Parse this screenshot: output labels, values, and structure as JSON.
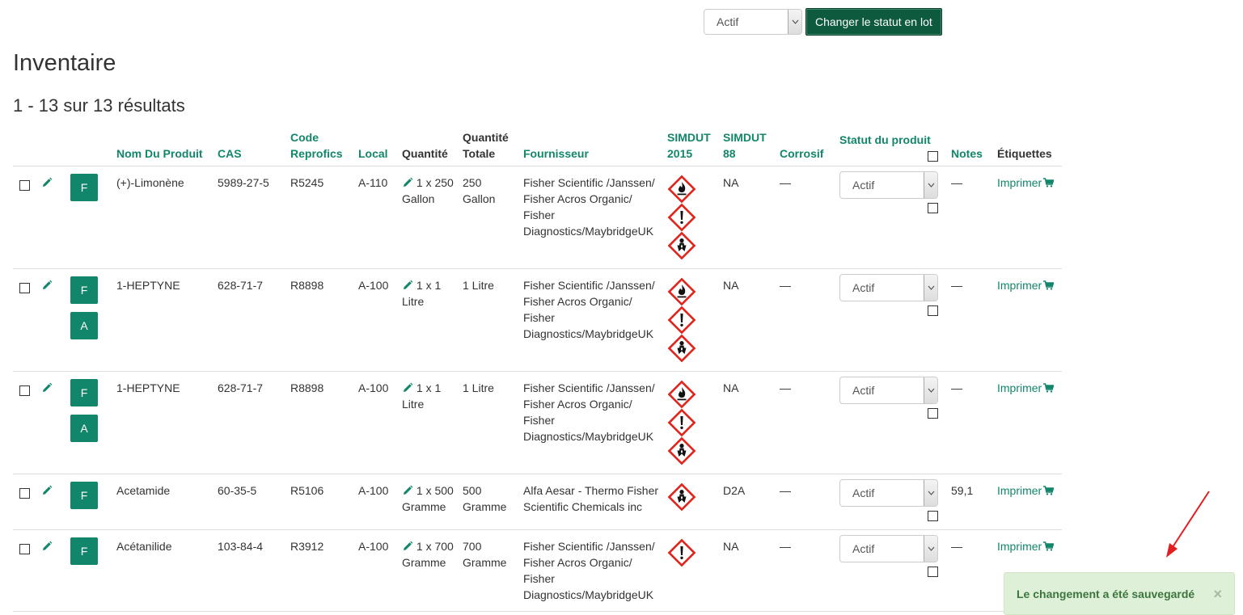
{
  "toolbar": {
    "status_value": "Actif",
    "batch_button": "Changer le statut en lot"
  },
  "page_title": "Inventaire",
  "result_count": "1 - 13 sur 13 résultats",
  "columns": {
    "name": "Nom Du Produit",
    "cas": "CAS",
    "code": "Code Reprofics",
    "local": "Local",
    "quantity": "Quantité",
    "total": "Quantité Totale",
    "supplier": "Fournisseur",
    "simdut2015": "SIMDUT 2015",
    "simdut88": "SIMDUT 88",
    "corrosive": "Corrosif",
    "status": "Statut du produit",
    "notes": "Notes",
    "labels": "Étiquettes"
  },
  "rows": [
    {
      "tags": [
        "F"
      ],
      "name": "(+)-Limonène",
      "cas": "5989-27-5",
      "code": "R5245",
      "local": "A-110",
      "quantity": "1 x 250 Gallon",
      "total": "250 Gallon",
      "supplier": "Fisher Scientific /Janssen/ Fisher Acros Organic/ Fisher Diagnostics/MaybridgeUK",
      "pictograms": [
        "flame-pictogram",
        "exclamation-pictogram",
        "health-hazard-pictogram"
      ],
      "simdut88": "NA",
      "corrosive": "—",
      "status": "Actif",
      "notes": "—",
      "print": "Imprimer"
    },
    {
      "tags": [
        "F",
        "A"
      ],
      "name": "1-HEPTYNE",
      "cas": "628-71-7",
      "code": "R8898",
      "local": "A-100",
      "quantity": "1 x 1 Litre",
      "total": "1 Litre",
      "supplier": "Fisher Scientific /Janssen/ Fisher Acros Organic/ Fisher Diagnostics/MaybridgeUK",
      "pictograms": [
        "flame-pictogram",
        "exclamation-pictogram",
        "health-hazard-pictogram"
      ],
      "simdut88": "NA",
      "corrosive": "—",
      "status": "Actif",
      "notes": "—",
      "print": "Imprimer"
    },
    {
      "tags": [
        "F",
        "A"
      ],
      "name": "1-HEPTYNE",
      "cas": "628-71-7",
      "code": "R8898",
      "local": "A-100",
      "quantity": "1 x 1 Litre",
      "total": "1 Litre",
      "supplier": "Fisher Scientific /Janssen/ Fisher Acros Organic/ Fisher Diagnostics/MaybridgeUK",
      "pictograms": [
        "flame-pictogram",
        "exclamation-pictogram",
        "health-hazard-pictogram"
      ],
      "simdut88": "NA",
      "corrosive": "—",
      "status": "Actif",
      "notes": "—",
      "print": "Imprimer"
    },
    {
      "tags": [
        "F"
      ],
      "name": "Acetamide",
      "cas": "60-35-5",
      "code": "R5106",
      "local": "A-100",
      "quantity": "1 x 500 Gramme",
      "total": "500 Gramme",
      "supplier": "Alfa Aesar - Thermo Fisher Scientific Chemicals inc",
      "pictograms": [
        "health-hazard-pictogram"
      ],
      "simdut88": "D2A",
      "corrosive": "—",
      "status": "Actif",
      "notes": "59,1",
      "print": "Imprimer"
    },
    {
      "tags": [
        "F"
      ],
      "name": "Acétanilide",
      "cas": "103-84-4",
      "code": "R3912",
      "local": "A-100",
      "quantity": "1 x 700 Gramme",
      "total": "700 Gramme",
      "supplier": "Fisher Scientific /Janssen/ Fisher Acros Organic/ Fisher Diagnostics/MaybridgeUK",
      "pictograms": [
        "exclamation-pictogram"
      ],
      "simdut88": "NA",
      "corrosive": "—",
      "status": "Actif",
      "notes": "—",
      "print": "Imprimer"
    }
  ],
  "toast": {
    "message": "Le changement a été sauvegardé",
    "close": "×"
  },
  "colors": {
    "accent": "#12866a",
    "button_dark": "#0d5a3e",
    "toast_bg": "#dff0d8",
    "toast_text": "#3c763d",
    "annotation_arrow": "#e02020"
  }
}
